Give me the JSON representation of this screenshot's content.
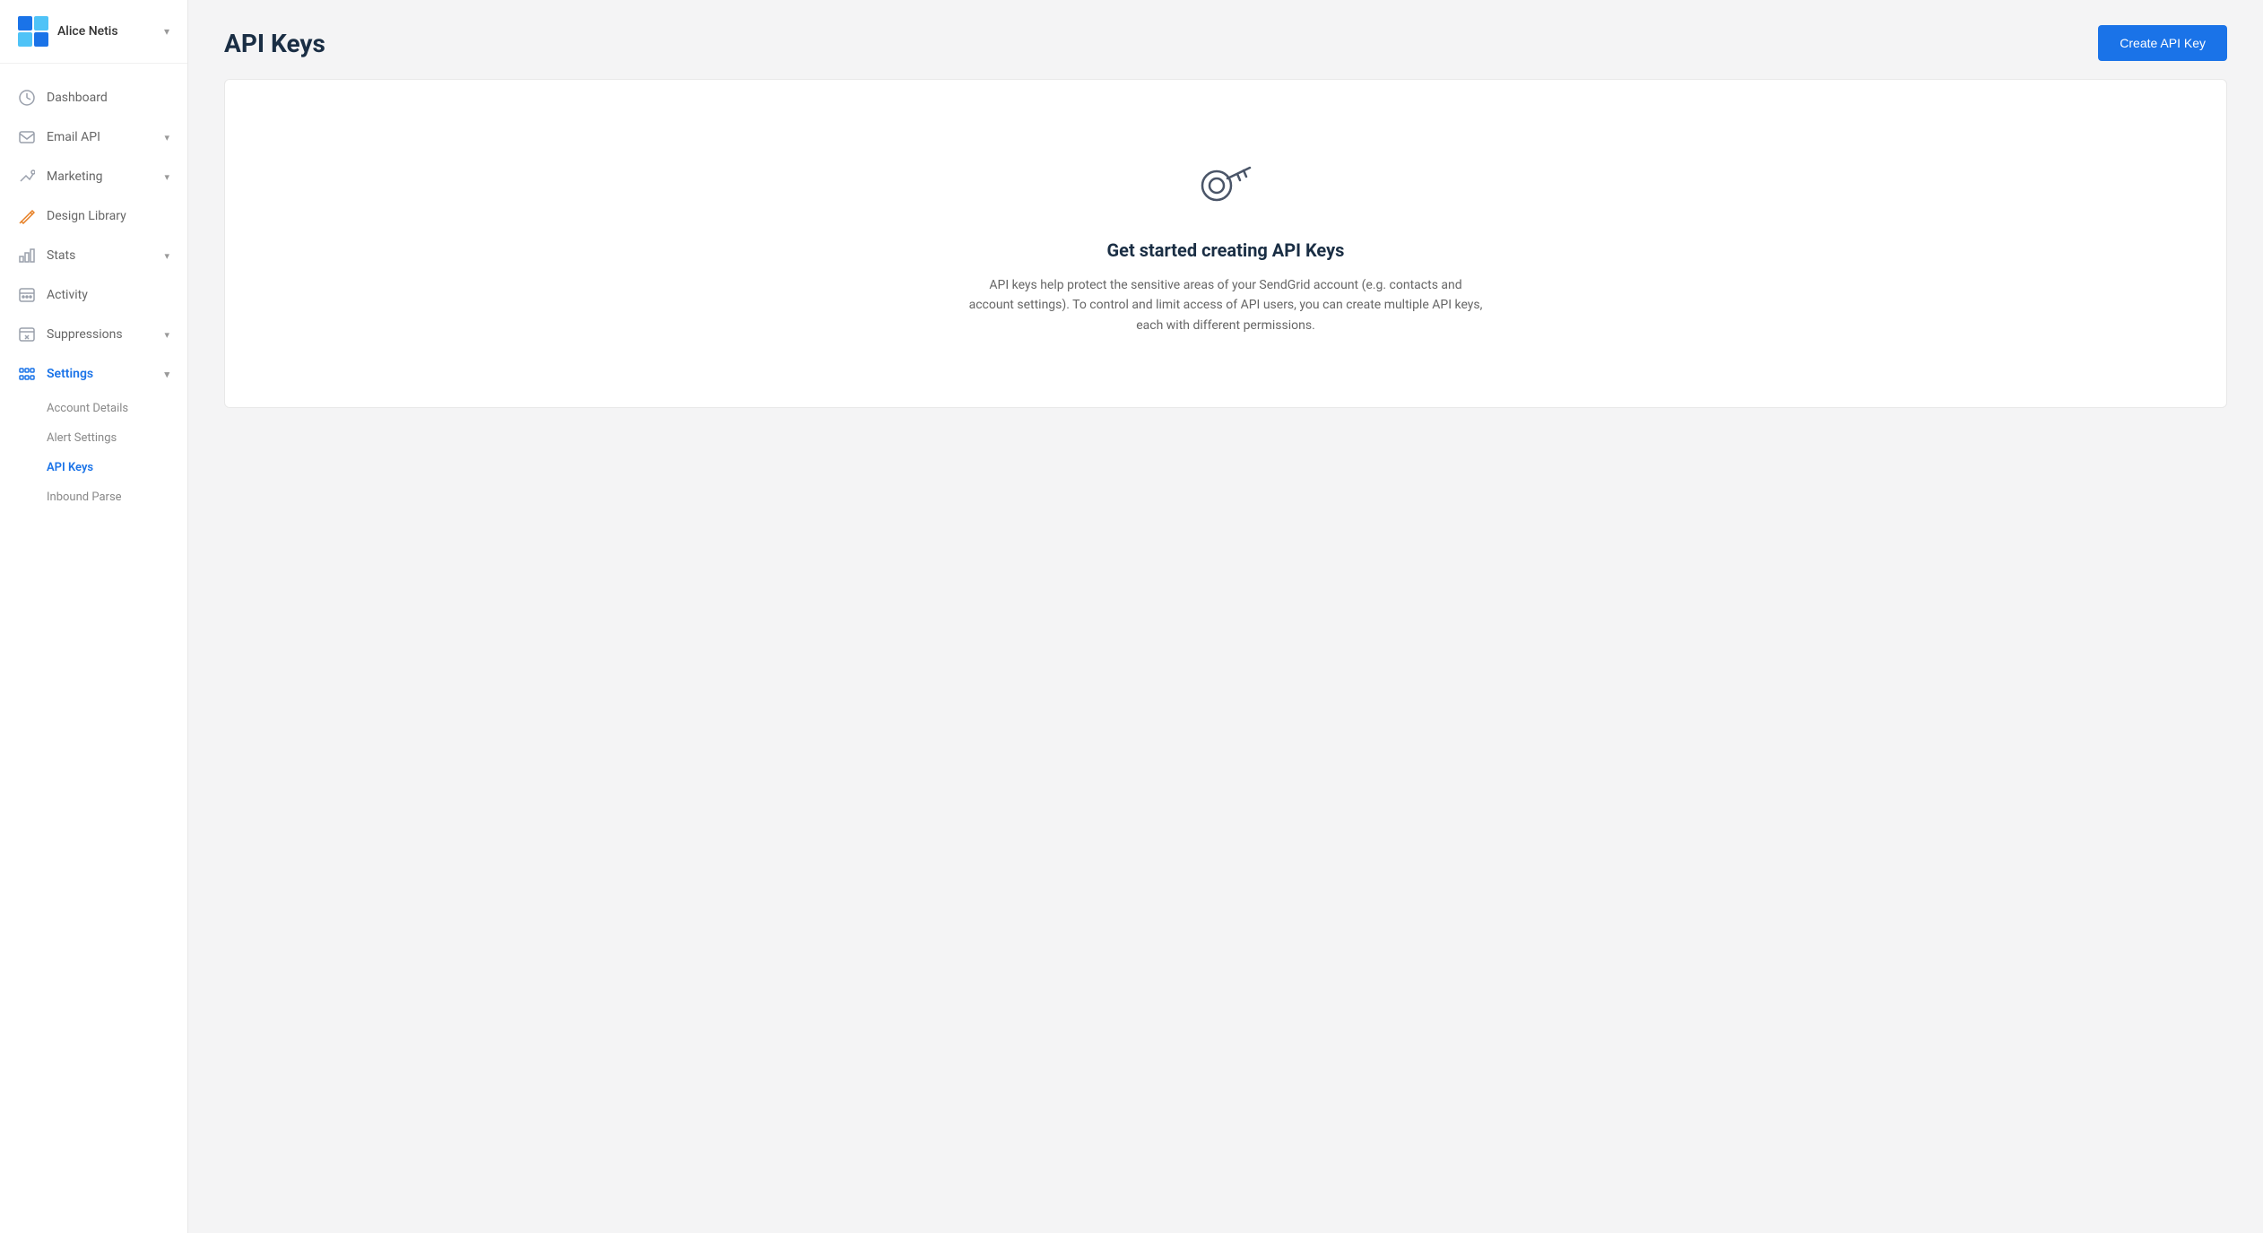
{
  "sidebar": {
    "user": {
      "name": "Alice Netis"
    },
    "nav_items": [
      {
        "id": "dashboard",
        "label": "Dashboard",
        "icon": "dashboard",
        "has_chevron": false
      },
      {
        "id": "email-api",
        "label": "Email API",
        "icon": "email-api",
        "has_chevron": true
      },
      {
        "id": "marketing",
        "label": "Marketing",
        "icon": "marketing",
        "has_chevron": true
      },
      {
        "id": "design-library",
        "label": "Design Library",
        "icon": "design-library",
        "has_chevron": false
      },
      {
        "id": "stats",
        "label": "Stats",
        "icon": "stats",
        "has_chevron": true
      },
      {
        "id": "activity",
        "label": "Activity",
        "icon": "activity",
        "has_chevron": false
      },
      {
        "id": "suppressions",
        "label": "Suppressions",
        "icon": "suppressions",
        "has_chevron": true
      },
      {
        "id": "settings",
        "label": "Settings",
        "icon": "settings",
        "has_chevron": true,
        "active": true
      }
    ],
    "settings_sub_items": [
      {
        "id": "account-details",
        "label": "Account Details",
        "active": false
      },
      {
        "id": "alert-settings",
        "label": "Alert Settings",
        "active": false
      },
      {
        "id": "api-keys",
        "label": "API Keys",
        "active": true
      },
      {
        "id": "inbound-parse",
        "label": "Inbound Parse",
        "active": false
      }
    ]
  },
  "header": {
    "title": "API Keys",
    "create_button_label": "Create API Key"
  },
  "empty_state": {
    "title": "Get started creating API Keys",
    "description": "API keys help protect the sensitive areas of your SendGrid account (e.g. contacts and account settings). To control and limit access of API users, you can create multiple API keys, each with different permissions."
  }
}
